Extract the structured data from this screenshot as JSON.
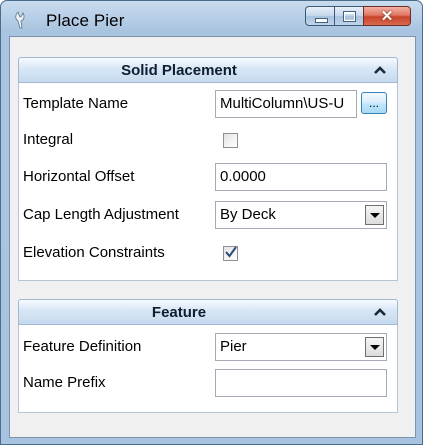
{
  "window": {
    "title": "Place Pier",
    "app_icon": "bentley-app-icon",
    "controls": {
      "minimize": "minimize-icon",
      "maximize": "maximize-icon",
      "close_glyph": "✕"
    }
  },
  "solid_placement": {
    "title": "Solid Placement",
    "collapse_icon": "chevron-up-icon",
    "template_name": {
      "label": "Template Name",
      "value": "MultiColumn\\US-U",
      "browse_label": "..."
    },
    "integral": {
      "label": "Integral",
      "checked": false
    },
    "horizontal_offset": {
      "label": "Horizontal Offset",
      "value": "0.0000"
    },
    "cap_length_adjustment": {
      "label": "Cap Length Adjustment",
      "value": "By Deck"
    },
    "elevation_constraints": {
      "label": "Elevation Constraints",
      "checked": true
    }
  },
  "feature": {
    "title": "Feature",
    "collapse_icon": "chevron-up-icon",
    "feature_definition": {
      "label": "Feature Definition",
      "value": "Pier"
    },
    "name_prefix": {
      "label": "Name Prefix",
      "value": ""
    }
  },
  "colors": {
    "frame": "#a9c4e0",
    "close_button": "#c8432a",
    "header_text": "#0f1e33"
  }
}
